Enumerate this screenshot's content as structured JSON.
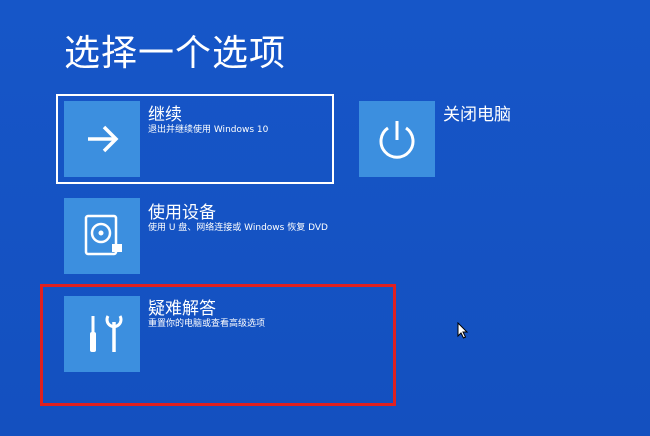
{
  "page": {
    "title": "选择一个选项"
  },
  "options": [
    {
      "title": "继续",
      "description": "退出并继续使用 Windows 10",
      "icon": "arrow-right-icon"
    },
    {
      "title": "关闭电脑",
      "description": "",
      "icon": "power-icon"
    },
    {
      "title": "使用设备",
      "description": "使用 U 盘、网络连接或 Windows 恢复 DVD",
      "icon": "disc-drive-icon"
    },
    {
      "title": "疑难解答",
      "description": "重置你的电脑或查看高级选项",
      "icon": "tools-icon"
    }
  ],
  "colors": {
    "background": "#1552c3",
    "tile": "#3c8fdf",
    "highlight": "#e02020"
  }
}
